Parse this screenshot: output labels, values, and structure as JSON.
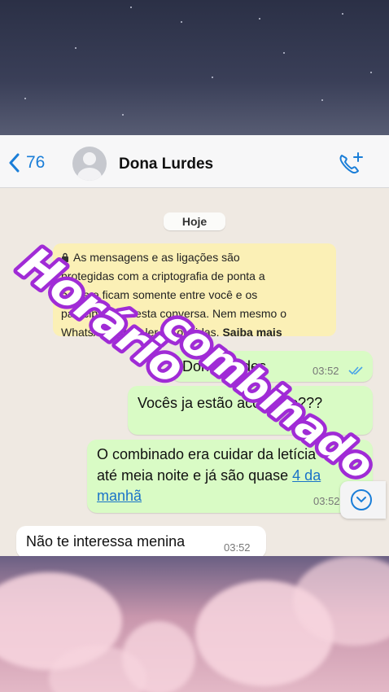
{
  "header": {
    "back_count": "76",
    "contact_name": "Dona Lurdes",
    "icons": {
      "back": "chevron-left-icon",
      "call": "add-call-icon",
      "avatar": "person-avatar-icon"
    }
  },
  "chat": {
    "date_chip": "Hoje",
    "encryption_notice": {
      "line1": "As mensagens e as ligações são",
      "line2": "protegidas com a criptografia de ponta a",
      "line3": "ponta e ficam somente entre você e os",
      "line4": "participantes desta conversa. Nem mesmo o",
      "line5_prefix": "WhatsApp pode ler ou ouvi-las. ",
      "learn_more": "Saiba mais"
    },
    "messages": [
      {
        "direction": "outgoing",
        "text": "Dona Lurdes",
        "time": "03:52",
        "read": true
      },
      {
        "direction": "outgoing",
        "text": "Vocês ja estão acordado???",
        "time": "03:52"
      },
      {
        "direction": "outgoing",
        "text_line1": "O combinado era cuidar da letícia",
        "text_line2_prefix": "até meia noite e já são quase ",
        "text_link_a": "4 da",
        "text_link_b": "manhã",
        "time": "03:52"
      },
      {
        "direction": "incoming",
        "text": "Não te interessa menina",
        "time": "03:52"
      }
    ],
    "scroll_down_icon": "chevron-down-icon"
  },
  "overlay": {
    "word1": "Horário",
    "word2": "combinado",
    "fill_color": "#ffffff",
    "stroke_color": "#a02bd6"
  },
  "colors": {
    "accent": "#1a7ed8",
    "outgoing_bubble": "#d9fbc5",
    "notice_bg": "#fbf0b6",
    "chat_bg": "#efe9e2"
  }
}
